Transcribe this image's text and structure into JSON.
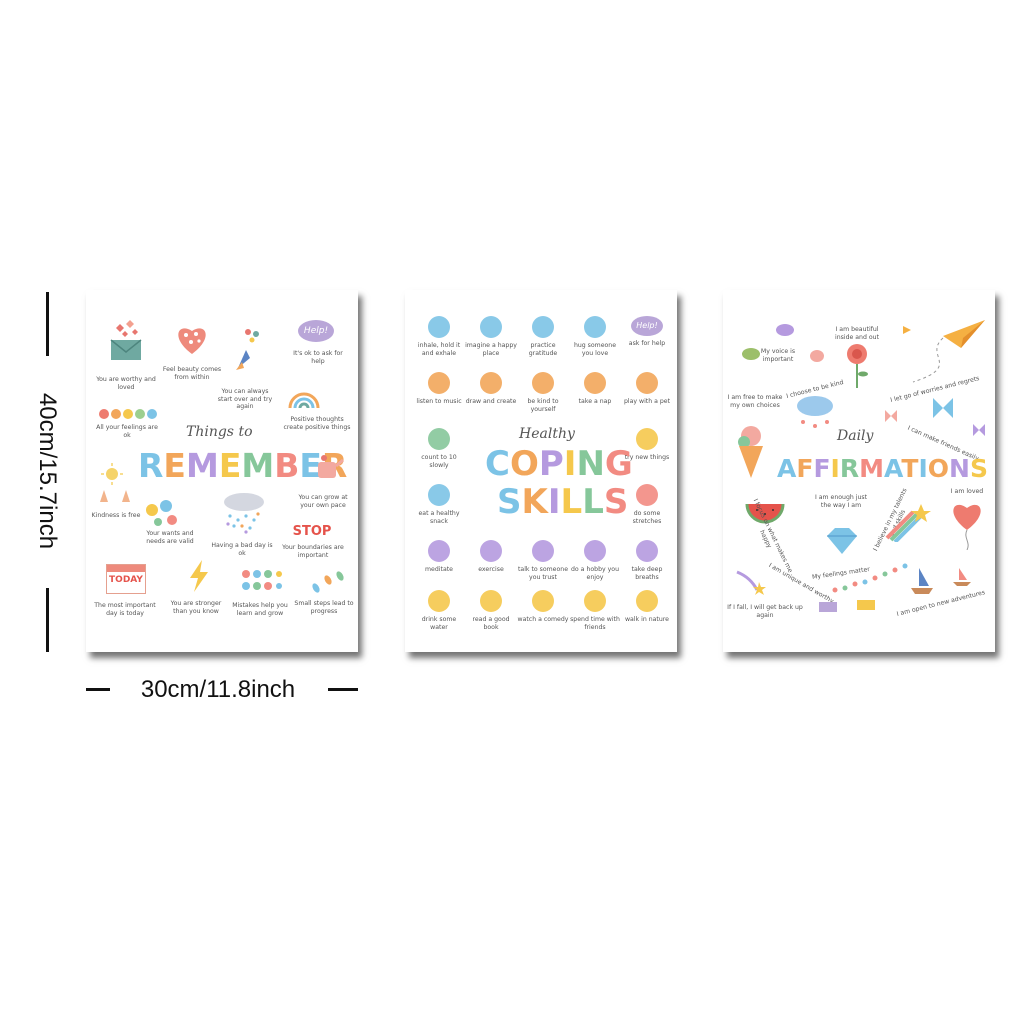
{
  "dimensions": {
    "height_label": "40cm/15.7inch",
    "width_label": "30cm/11.8inch"
  },
  "poster1": {
    "title_script": "Things to",
    "title_big": "REMEMBER",
    "title_colors": [
      "#7cc3e6",
      "#f2a65a",
      "#b59adf",
      "#f5c84c",
      "#86c79a",
      "#f28b82",
      "#7cc3e6",
      "#f2a65a"
    ],
    "items": [
      "You are worthy and loved",
      "Feel beauty comes from within",
      "You can always start over and try again",
      "It's ok to ask for help",
      "All your feelings are ok",
      "Positive thoughts create positive things",
      "Kindness is free",
      "You can grow at your own pace",
      "Your wants and needs are valid",
      "Having a bad day is ok",
      "Your boundaries are important",
      "The most important day is today",
      "You are stronger than you know",
      "Mistakes help you learn and grow",
      "Small steps lead to progress"
    ],
    "help_bubble": "Help!",
    "stop_sign": "STOP",
    "today_label": "TODAY"
  },
  "poster2": {
    "title_script": "Healthy",
    "title_big_1": "COPING",
    "title_big_2": "SKILLS",
    "items": [
      "inhale, hold it and exhale",
      "imagine a happy place",
      "practice gratitude",
      "hug someone you love",
      "ask for help",
      "listen to music",
      "draw and create",
      "be kind to yourself",
      "take a nap",
      "play with a pet",
      "count to 10 slowly",
      "try new things",
      "eat a healthy snack",
      "do some stretches",
      "meditate",
      "exercise",
      "talk to someone you trust",
      "do a hobby you enjoy",
      "take deep breaths",
      "drink some water",
      "read a good book",
      "watch a comedy",
      "spend time with friends",
      "walk in nature"
    ],
    "help_bubble": "Help!"
  },
  "poster3": {
    "title_script": "Daily",
    "title_big": "AFFIRMATIONS",
    "items": [
      "I am beautiful inside and out",
      "My voice is important",
      "I let go of worries and regrets",
      "I am free to make my own choices",
      "I choose to be kind",
      "I can make friends easily",
      "I am enough just the way I am",
      "I believe in my talents and skills",
      "I am loved",
      "I focus on what makes me happy",
      "My feelings matter",
      "I am unique and worthy",
      "If I fall, I will get back up again",
      "I am open to new adventures"
    ]
  }
}
